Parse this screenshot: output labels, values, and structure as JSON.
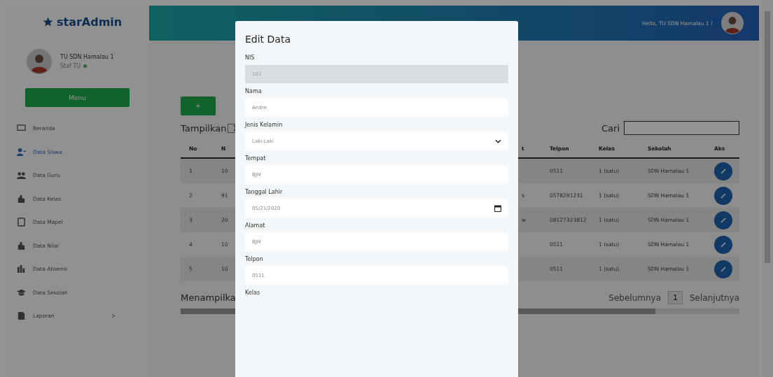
{
  "sidebar": {
    "logo": "starAdmin",
    "profile": {
      "name": "TU SDN Hamalau 1",
      "role": "Staf TU",
      "online": true
    },
    "menu_button": "Menu",
    "items": [
      {
        "label": "Beranda",
        "selected": false,
        "kind": "monitor",
        "has_caret": false
      },
      {
        "label": "Data Siswa",
        "selected": true,
        "kind": "user",
        "has_caret": false
      },
      {
        "label": "Data Guru",
        "selected": false,
        "kind": "users",
        "has_caret": false
      },
      {
        "label": "Data Kelas",
        "selected": false,
        "kind": "building",
        "has_caret": false
      },
      {
        "label": "Data Mapel",
        "selected": false,
        "kind": "book",
        "has_caret": false
      },
      {
        "label": "Data Nilai",
        "selected": false,
        "kind": "building",
        "has_caret": false
      },
      {
        "label": "Data Absensi",
        "selected": false,
        "kind": "chart",
        "has_caret": false
      },
      {
        "label": "Data Sekolah",
        "selected": false,
        "kind": "cap",
        "has_caret": false
      },
      {
        "label": "Laporan",
        "selected": false,
        "kind": "file",
        "has_caret": true
      }
    ]
  },
  "navbar": {
    "greeting": "Hello, TU SDN Hamalau 1 !"
  },
  "content": {
    "add_button": "+",
    "show_label": "Tampilkan",
    "show_value": "1",
    "search_label": "Cari",
    "table": {
      "columns": [
        "No",
        "N",
        "t",
        "Telpon",
        "Kelas",
        "Sekolah",
        "Aks"
      ],
      "rows": [
        {
          "cells": [
            "1",
            "10",
            "",
            "0511",
            "1 (satu)",
            "SDN Hamalau 1"
          ]
        },
        {
          "cells": [
            "2",
            "91",
            "s",
            "0578291231",
            "1 (satu)",
            "SDN Hamalau 1"
          ]
        },
        {
          "cells": [
            "3",
            "20",
            "w",
            "08127323812",
            "1 (satu)",
            "SDN Hamalau 1"
          ]
        },
        {
          "cells": [
            "4",
            "10",
            "",
            "0511",
            "1 (satu)",
            "SDN Hamalau 1"
          ]
        },
        {
          "cells": [
            "5",
            "10",
            "",
            "0511",
            "1 (satu)",
            "SDN Hamalau 1"
          ]
        }
      ]
    },
    "info": "Menampilka",
    "pagination": {
      "previous": "Sebelumnya",
      "pages": [
        {
          "label": "1",
          "selected": true
        }
      ],
      "next": "Selanjutnya"
    }
  },
  "modal": {
    "title": "Edit Data",
    "fields": [
      {
        "label": "NIS",
        "value": "101",
        "kind": "text",
        "disabled": true
      },
      {
        "label": "Nama",
        "value": "Andre",
        "kind": "text",
        "disabled": false
      },
      {
        "label": "Jenis Kelamin",
        "value": "Laki-Laki",
        "kind": "select",
        "disabled": false
      },
      {
        "label": "Tempat",
        "value": "BJM",
        "kind": "text",
        "disabled": false
      },
      {
        "label": "Tanggal Lahir",
        "value": "05/21/2020",
        "kind": "date",
        "disabled": false
      },
      {
        "label": "Alamat",
        "value": "BJM",
        "kind": "text",
        "disabled": false
      },
      {
        "label": "Telpon",
        "value": "0511",
        "kind": "text",
        "disabled": false
      },
      {
        "label": "Kelas",
        "kind": "label_only"
      }
    ]
  }
}
